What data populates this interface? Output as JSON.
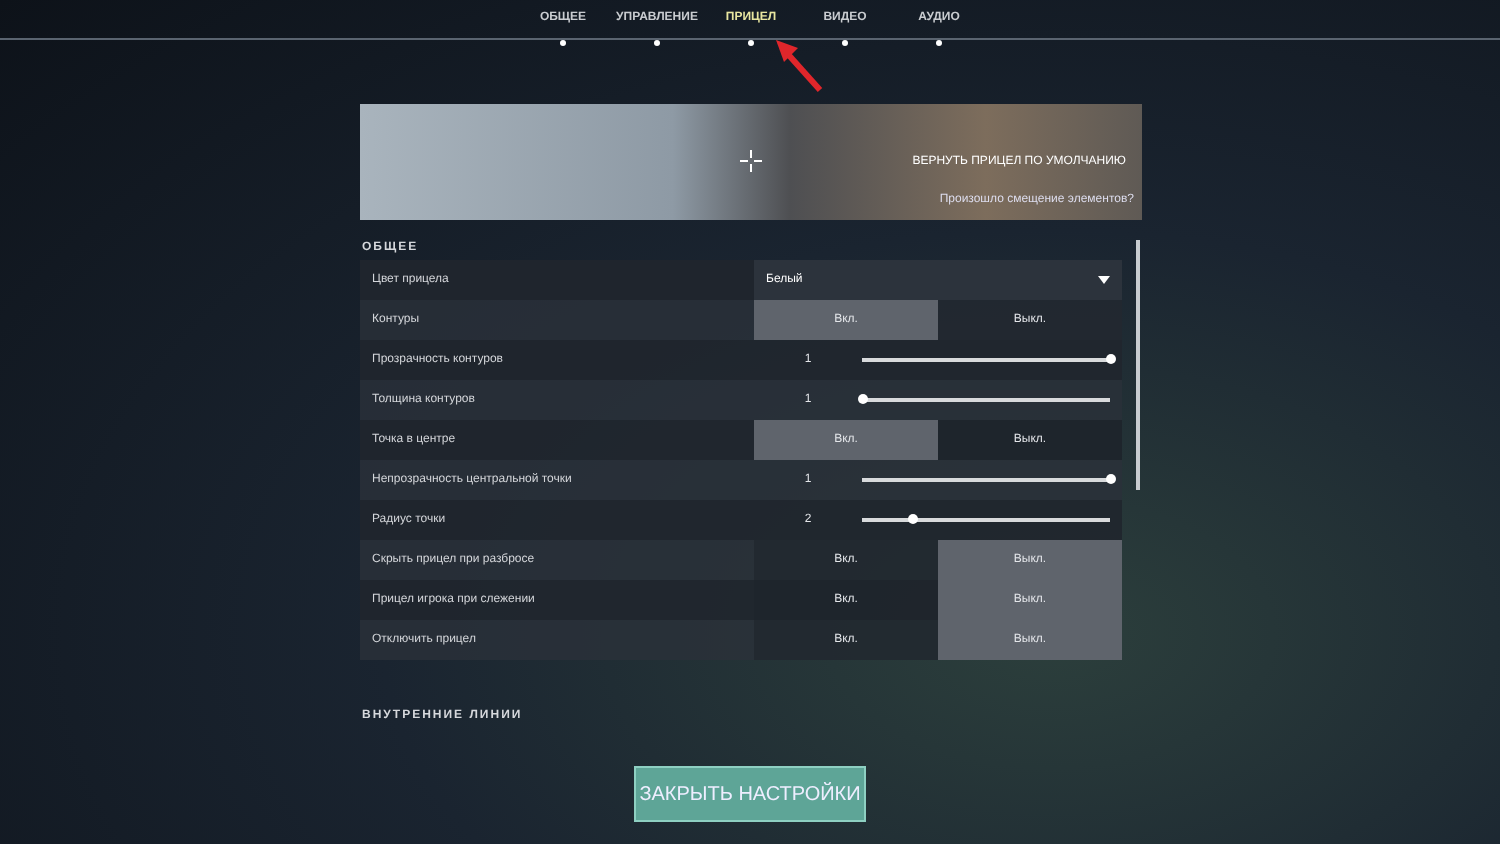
{
  "tabs": [
    {
      "label": "ОБЩЕЕ",
      "selected": false
    },
    {
      "label": "УПРАВЛЕНИЕ",
      "selected": false
    },
    {
      "label": "ПРИЦЕЛ",
      "selected": true
    },
    {
      "label": "ВИДЕО",
      "selected": false
    },
    {
      "label": "АУДИО",
      "selected": false
    }
  ],
  "preview": {
    "reset_link": "ВЕРНУТЬ ПРИЦЕЛ ПО УМОЛЧАНИЮ",
    "offset_link": "Произошло смещение элементов?"
  },
  "sections": [
    {
      "title": "ОБЩЕЕ",
      "rows": [
        {
          "kind": "dropdown",
          "label": "Цвет прицела",
          "value": "Белый"
        },
        {
          "kind": "toggle",
          "label": "Контуры",
          "options": [
            {
              "label": "Вкл.",
              "selected": true
            },
            {
              "label": "Выкл.",
              "selected": false
            }
          ]
        },
        {
          "kind": "slider",
          "label": "Прозрачность контуров",
          "value": "1",
          "level": 1
        },
        {
          "kind": "slider",
          "label": "Толщина контуров",
          "value": "1",
          "level": 0
        },
        {
          "kind": "toggle",
          "label": "Точка в центре",
          "options": [
            {
              "label": "Вкл.",
              "selected": true
            },
            {
              "label": "Выкл.",
              "selected": false
            }
          ]
        },
        {
          "kind": "slider",
          "label": "Непрозрачность центральной точки",
          "value": "1",
          "level": 1
        },
        {
          "kind": "slider",
          "label": "Радиус точки",
          "value": "2",
          "level": 0.2
        },
        {
          "kind": "toggle",
          "label": "Скрыть прицел при разбросе",
          "options": [
            {
              "label": "Вкл.",
              "selected": false
            },
            {
              "label": "Выкл.",
              "selected": true
            }
          ]
        },
        {
          "kind": "toggle",
          "label": "Прицел игрока при слежении",
          "options": [
            {
              "label": "Вкл.",
              "selected": false
            },
            {
              "label": "Выкл.",
              "selected": true
            }
          ]
        },
        {
          "kind": "toggle",
          "label": "Отключить прицел",
          "options": [
            {
              "label": "Вкл.",
              "selected": false
            },
            {
              "label": "Выкл.",
              "selected": true
            }
          ]
        }
      ]
    },
    {
      "title": "ВНУТРЕННИЕ ЛИНИИ"
    }
  ],
  "close_button": "ЗАКРЫТЬ НАСТРОЙКИ"
}
